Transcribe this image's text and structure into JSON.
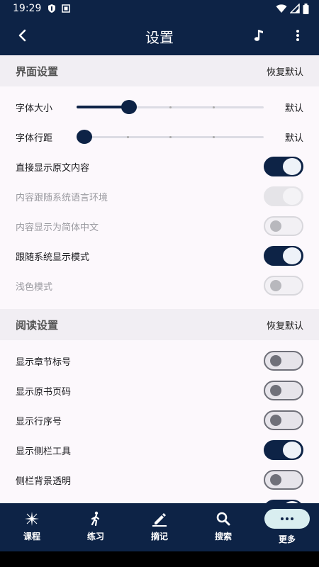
{
  "status_bar": {
    "time": "19:29"
  },
  "app_bar": {
    "title": "设置"
  },
  "sections": [
    {
      "title": "界面设置",
      "reset_label": "恢复默认",
      "sliders": [
        {
          "label": "字体大小",
          "value_label": "默认",
          "value": 0.26,
          "ticks": 5
        },
        {
          "label": "字体行距",
          "value_label": "默认",
          "value": 0.0,
          "ticks": 5
        }
      ],
      "switches": [
        {
          "label": "直接显示原文内容",
          "state": "on",
          "enabled": true
        },
        {
          "label": "内容跟随系统语言环境",
          "state": "on",
          "enabled": false
        },
        {
          "label": "内容显示为简体中文",
          "state": "off",
          "enabled": false
        },
        {
          "label": "跟随系统显示模式",
          "state": "on",
          "enabled": true
        },
        {
          "label": "浅色模式",
          "state": "off",
          "enabled": false
        }
      ]
    },
    {
      "title": "阅读设置",
      "reset_label": "恢复默认",
      "switches": [
        {
          "label": "显示章节标号",
          "state": "off",
          "enabled": true
        },
        {
          "label": "显示原书页码",
          "state": "off",
          "enabled": true
        },
        {
          "label": "显示行序号",
          "state": "off",
          "enabled": true
        },
        {
          "label": "显示侧栏工具",
          "state": "on",
          "enabled": true
        },
        {
          "label": "侧栏背景透明",
          "state": "off",
          "enabled": true
        }
      ]
    }
  ],
  "bottom_nav": [
    {
      "label": "课程",
      "icon": "sparkle-icon"
    },
    {
      "label": "练习",
      "icon": "walking-person-icon"
    },
    {
      "label": "摘记",
      "icon": "pencil-icon"
    },
    {
      "label": "搜索",
      "icon": "search-icon"
    },
    {
      "label": "更多",
      "icon": "more-horizontal-icon",
      "active": true
    }
  ],
  "colors": {
    "primary": "#0d2346",
    "background": "#fcf8fc",
    "section_header_bg": "#f1eef3",
    "nav_active_pill": "#d9eef0"
  }
}
